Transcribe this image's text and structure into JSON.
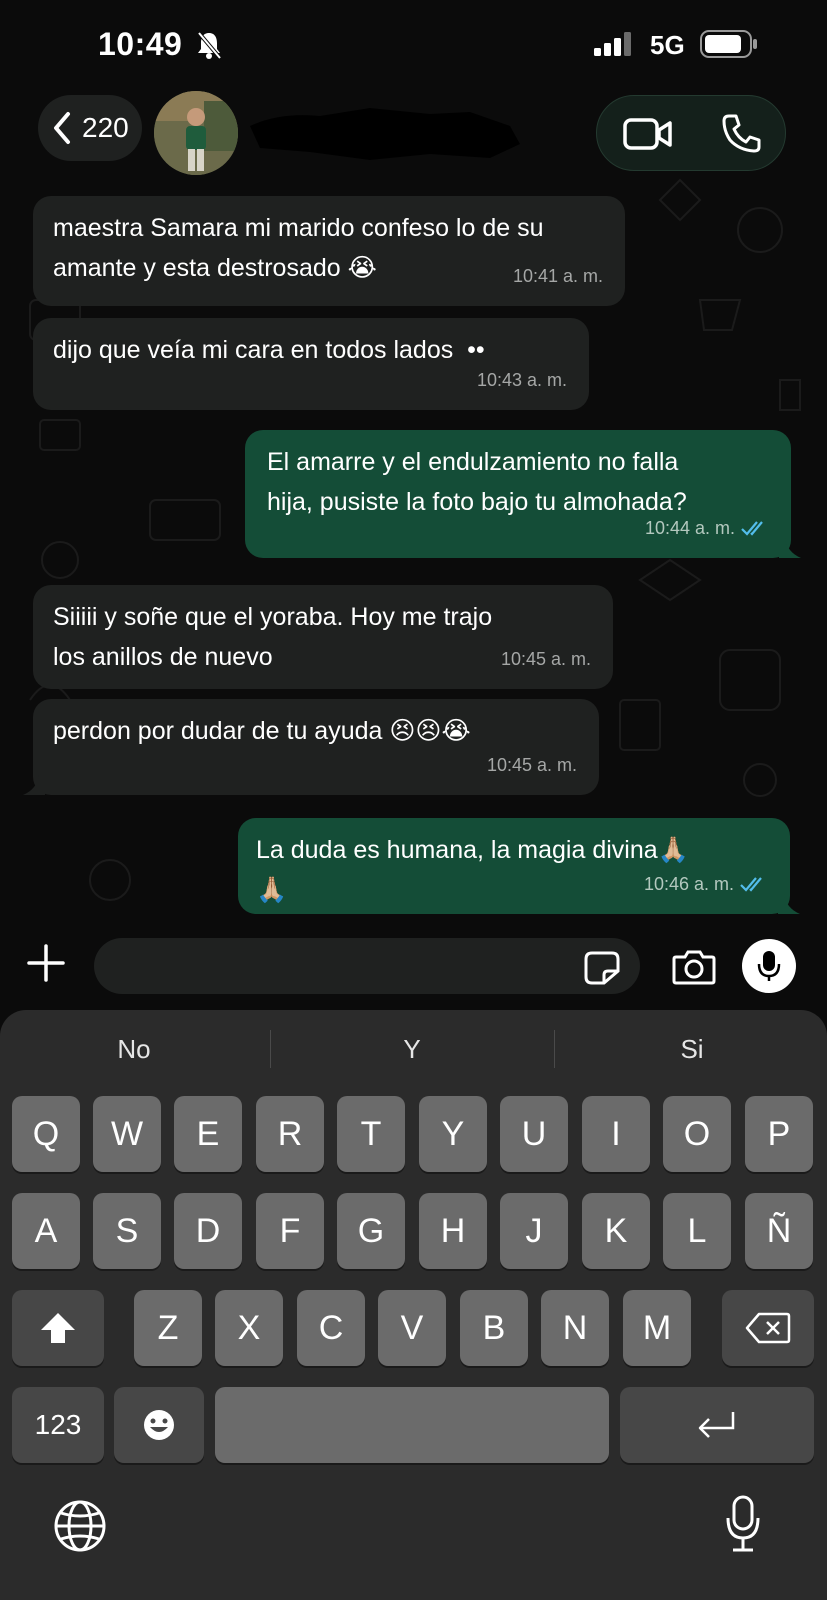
{
  "status_bar": {
    "time": "10:49",
    "network": "5G",
    "icons": [
      "bell-slash-icon",
      "signal-icon",
      "battery-icon"
    ]
  },
  "header": {
    "back_count": "220",
    "icons": [
      "chevron-left-icon",
      "video-camera-icon",
      "phone-icon"
    ]
  },
  "messages": [
    {
      "direction": "incoming",
      "text": "maestra Samara mi marido confeso lo de su\namante y esta destrosado 😭",
      "time": "10:41 a. m."
    },
    {
      "direction": "incoming",
      "text": "dijo que veía mi cara en todos lados  ••",
      "time": "10:43 a. m."
    },
    {
      "direction": "outgoing",
      "text": "El amarre y el endulzamiento no falla\nhija, pusiste la foto bajo tu almohada?",
      "time": "10:44 a. m.",
      "read": true
    },
    {
      "direction": "incoming",
      "text": "Siiiii y soñe que el yoraba. Hoy me trajo\nlos anillos de nuevo",
      "time": "10:45 a. m."
    },
    {
      "direction": "incoming",
      "text": "perdon por dudar de tu ayuda 😣😣😭",
      "time": "10:45 a. m."
    },
    {
      "direction": "outgoing",
      "text": "La duda es humana, la magia divina🙏🏼\n🙏🏼",
      "time": "10:46 a. m.",
      "read": true
    }
  ],
  "input_bar": {
    "placeholder": "",
    "icons": [
      "plus-icon",
      "sticker-icon",
      "camera-icon",
      "microphone-icon"
    ]
  },
  "keyboard": {
    "suggestions": [
      "No",
      "Y",
      "Si"
    ],
    "row1": [
      "Q",
      "W",
      "E",
      "R",
      "T",
      "Y",
      "U",
      "I",
      "O",
      "P"
    ],
    "row2": [
      "A",
      "S",
      "D",
      "F",
      "G",
      "H",
      "J",
      "K",
      "L",
      "Ñ"
    ],
    "row3": [
      "Z",
      "X",
      "C",
      "V",
      "B",
      "N",
      "M"
    ],
    "numbers_key": "123",
    "icons": [
      "shift-icon",
      "backspace-icon",
      "emoji-icon",
      "return-icon",
      "globe-icon",
      "dictation-mic-icon"
    ]
  },
  "colors": {
    "incoming_bubble": "#1f2120",
    "outgoing_bubble": "#144d37",
    "read_ticks": "#53bdeb",
    "keyboard_bg": "#2b2b2b",
    "key_bg": "#6b6b6b"
  }
}
